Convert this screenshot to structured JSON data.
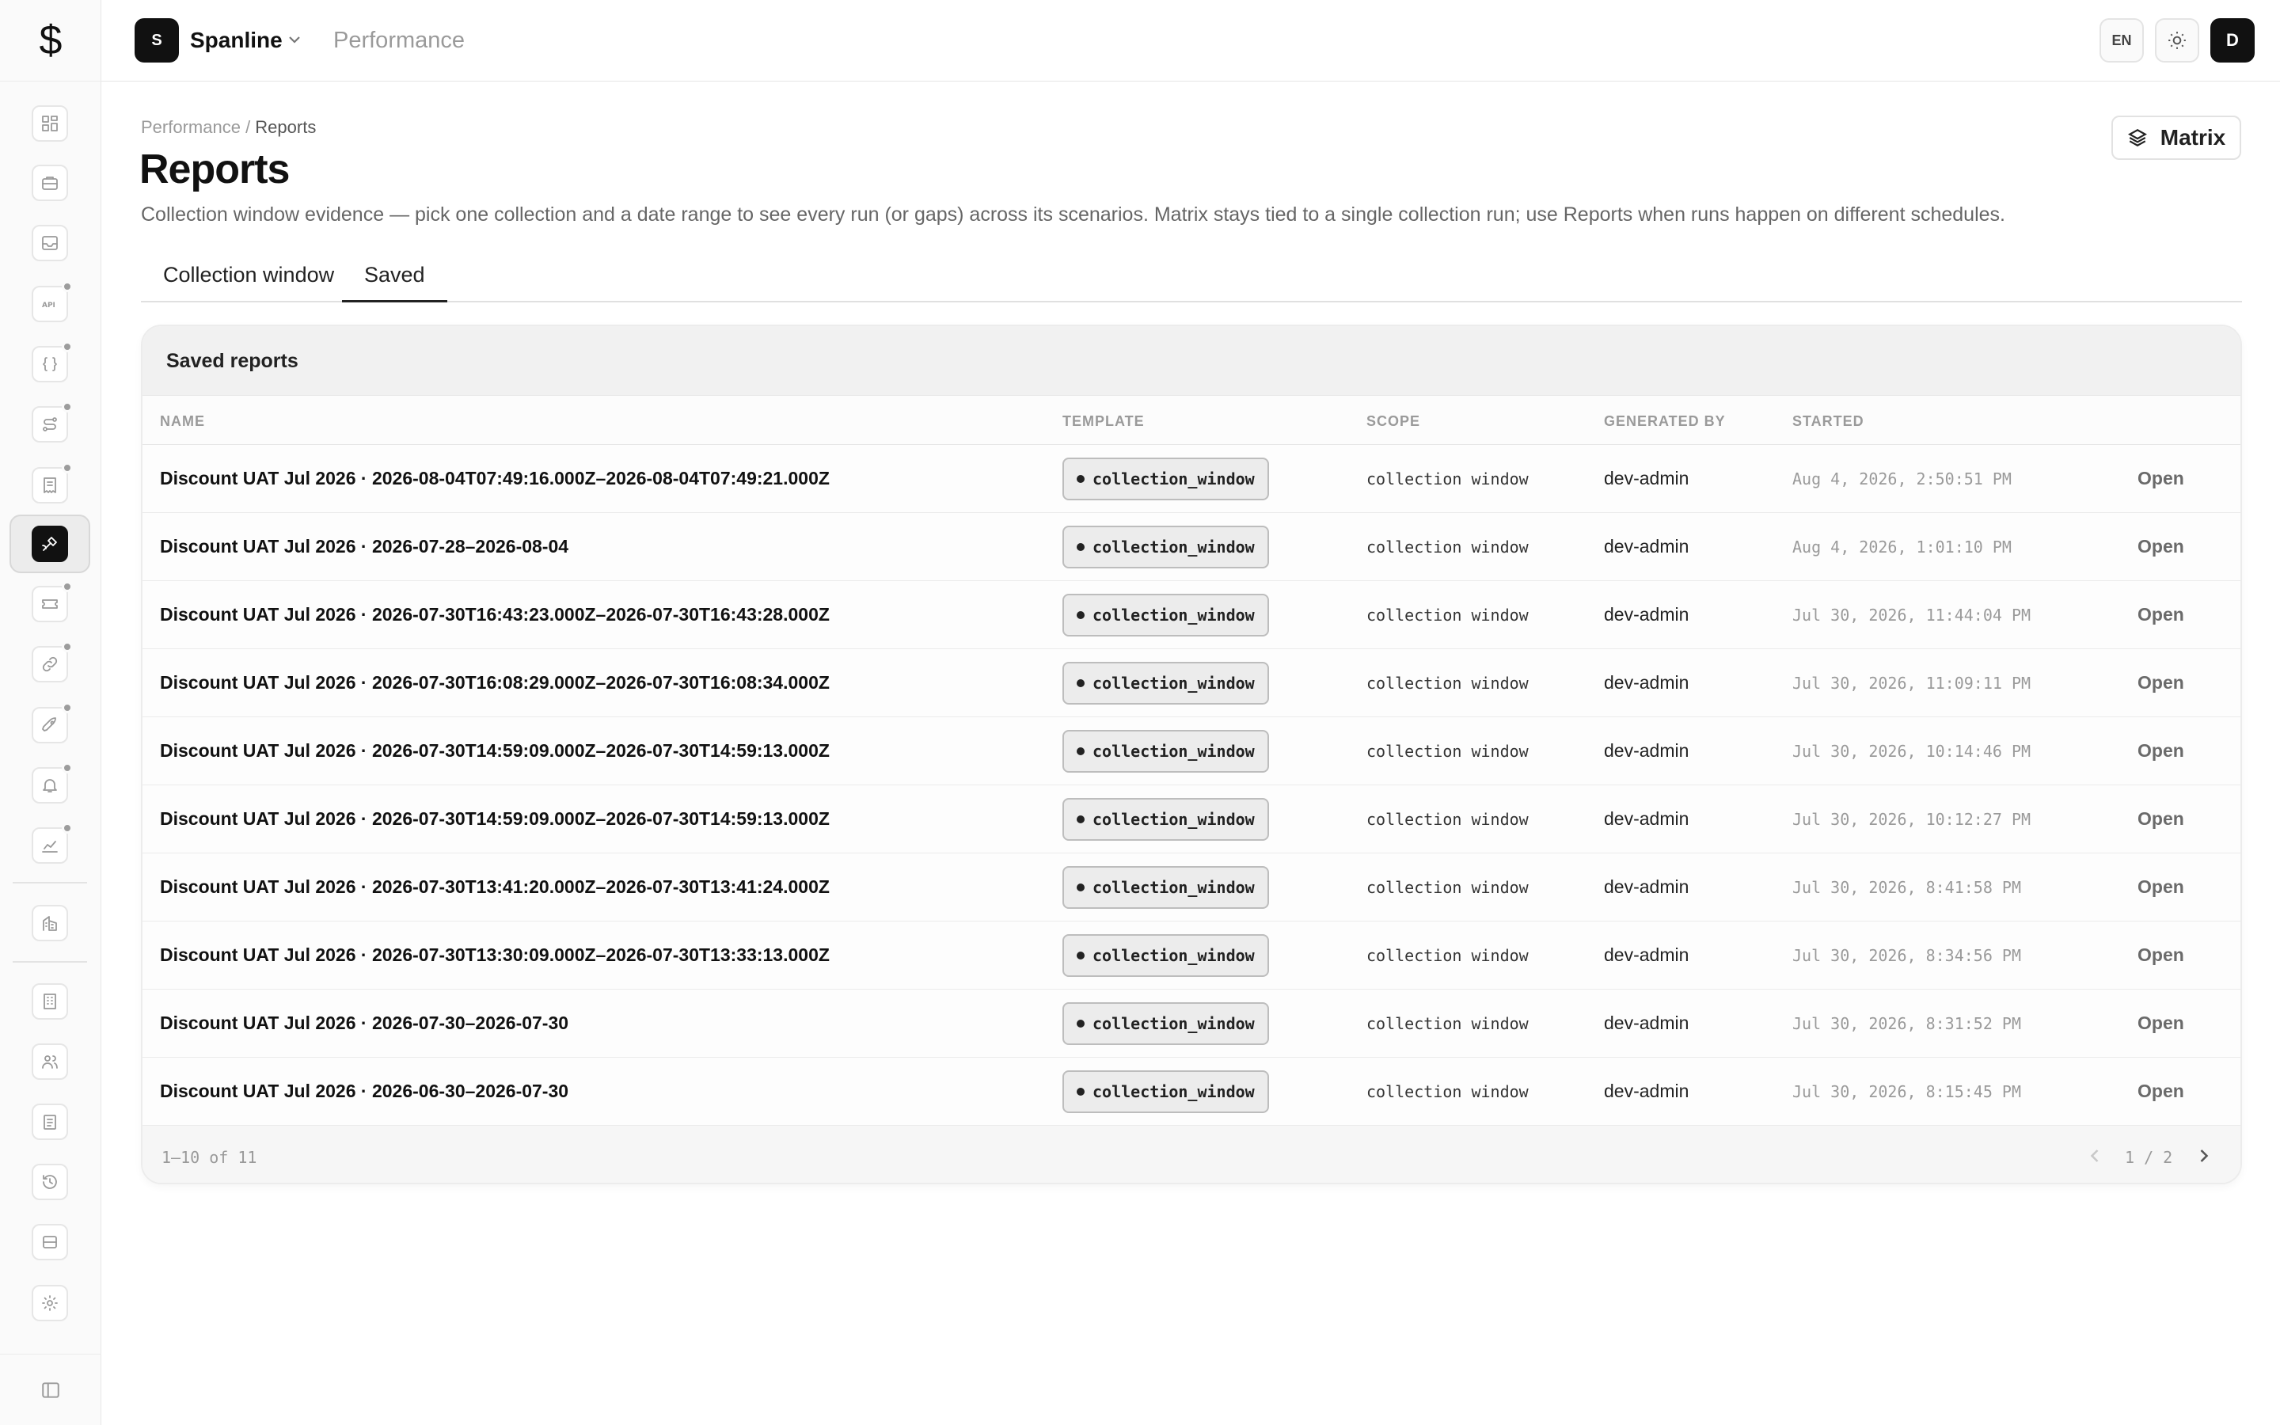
{
  "app": {
    "logo_glyph": "$",
    "workspace_initial": "S",
    "workspace_name": "Spanline",
    "section": "Performance"
  },
  "header": {
    "language": "EN",
    "user_initial": "D"
  },
  "sidebar": {
    "items": [
      {
        "icon": "dashboard-icon"
      },
      {
        "icon": "briefcase-icon"
      },
      {
        "icon": "inbox-icon"
      },
      {
        "icon": "api-icon",
        "dot": true
      },
      {
        "icon": "braces-icon",
        "dot": true
      },
      {
        "icon": "route-icon",
        "dot": true
      },
      {
        "icon": "receipt-icon",
        "dot": true
      },
      {
        "icon": "performance-icon",
        "active": true
      },
      {
        "icon": "ticket-icon",
        "dot": true
      },
      {
        "icon": "link-icon",
        "dot": true
      },
      {
        "icon": "rocket-icon",
        "dot": true
      },
      {
        "icon": "bell-icon",
        "dot": true
      },
      {
        "icon": "chart-icon",
        "dot": true
      },
      {
        "icon": "buildings-icon"
      },
      {
        "icon": "building-icon"
      },
      {
        "icon": "users-icon"
      },
      {
        "icon": "clipboard-icon"
      },
      {
        "icon": "history-icon"
      },
      {
        "icon": "database-icon"
      },
      {
        "icon": "gear-icon"
      }
    ],
    "footer_icon": "sidebar-toggle-icon"
  },
  "breadcrumb": {
    "parent": "Performance",
    "separator": " / ",
    "current": "Reports"
  },
  "page": {
    "title": "Reports",
    "description": "Collection window evidence — pick one collection and a date range to see every run (or gaps) across its scenarios. Matrix stays tied to a single collection run; use Reports when runs happen on different schedules.",
    "matrix_label": "Matrix"
  },
  "tabs": [
    {
      "label": "Collection window",
      "active": false
    },
    {
      "label": "Saved",
      "active": true
    }
  ],
  "card": {
    "title": "Saved reports",
    "columns": {
      "name": "NAME",
      "template": "TEMPLATE",
      "scope": "SCOPE",
      "generated_by": "GENERATED BY",
      "started": "STARTED"
    },
    "rows": [
      {
        "name": "Discount UAT Jul 2026 · 2026-08-04T07:49:16.000Z–2026-08-04T07:49:21.000Z",
        "template": "collection_window",
        "scope": "collection window",
        "generated_by": "dev-admin",
        "started": "Aug 4, 2026, 2:50:51 PM",
        "action": "Open"
      },
      {
        "name": "Discount UAT Jul 2026 · 2026-07-28–2026-08-04",
        "template": "collection_window",
        "scope": "collection window",
        "generated_by": "dev-admin",
        "started": "Aug 4, 2026, 1:01:10 PM",
        "action": "Open"
      },
      {
        "name": "Discount UAT Jul 2026 · 2026-07-30T16:43:23.000Z–2026-07-30T16:43:28.000Z",
        "template": "collection_window",
        "scope": "collection window",
        "generated_by": "dev-admin",
        "started": "Jul 30, 2026, 11:44:04 PM",
        "action": "Open"
      },
      {
        "name": "Discount UAT Jul 2026 · 2026-07-30T16:08:29.000Z–2026-07-30T16:08:34.000Z",
        "template": "collection_window",
        "scope": "collection window",
        "generated_by": "dev-admin",
        "started": "Jul 30, 2026, 11:09:11 PM",
        "action": "Open"
      },
      {
        "name": "Discount UAT Jul 2026 · 2026-07-30T14:59:09.000Z–2026-07-30T14:59:13.000Z",
        "template": "collection_window",
        "scope": "collection window",
        "generated_by": "dev-admin",
        "started": "Jul 30, 2026, 10:14:46 PM",
        "action": "Open"
      },
      {
        "name": "Discount UAT Jul 2026 · 2026-07-30T14:59:09.000Z–2026-07-30T14:59:13.000Z",
        "template": "collection_window",
        "scope": "collection window",
        "generated_by": "dev-admin",
        "started": "Jul 30, 2026, 10:12:27 PM",
        "action": "Open"
      },
      {
        "name": "Discount UAT Jul 2026 · 2026-07-30T13:41:20.000Z–2026-07-30T13:41:24.000Z",
        "template": "collection_window",
        "scope": "collection window",
        "generated_by": "dev-admin",
        "started": "Jul 30, 2026, 8:41:58 PM",
        "action": "Open"
      },
      {
        "name": "Discount UAT Jul 2026 · 2026-07-30T13:30:09.000Z–2026-07-30T13:33:13.000Z",
        "template": "collection_window",
        "scope": "collection window",
        "generated_by": "dev-admin",
        "started": "Jul 30, 2026, 8:34:56 PM",
        "action": "Open"
      },
      {
        "name": "Discount UAT Jul 2026 · 2026-07-30–2026-07-30",
        "template": "collection_window",
        "scope": "collection window",
        "generated_by": "dev-admin",
        "started": "Jul 30, 2026, 8:31:52 PM",
        "action": "Open"
      },
      {
        "name": "Discount UAT Jul 2026 · 2026-06-30–2026-07-30",
        "template": "collection_window",
        "scope": "collection window",
        "generated_by": "dev-admin",
        "started": "Jul 30, 2026, 8:15:45 PM",
        "action": "Open"
      }
    ],
    "footer": {
      "count": "1–10 of 11",
      "page": "1 / 2"
    }
  }
}
